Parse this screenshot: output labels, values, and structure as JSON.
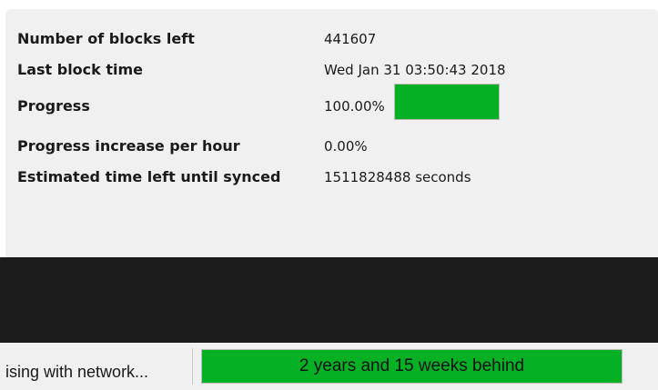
{
  "sync_panel": {
    "rows": [
      {
        "label": "Number of blocks left",
        "value": "441607"
      },
      {
        "label": "Last block time",
        "value": "Wed Jan 31 03:50:43 2018"
      },
      {
        "label": "Progress",
        "value": "100.00%"
      },
      {
        "label": "Progress increase per hour",
        "value": "0.00%"
      },
      {
        "label": "Estimated time left until synced",
        "value": "1511828488 seconds"
      }
    ],
    "progress_fraction": 1.0,
    "progress_color": "#06b025"
  },
  "status_bar": {
    "sync_status": "ising with network...",
    "behind_label": "2 years and 15 weeks behind",
    "behind_color": "#06b025"
  }
}
